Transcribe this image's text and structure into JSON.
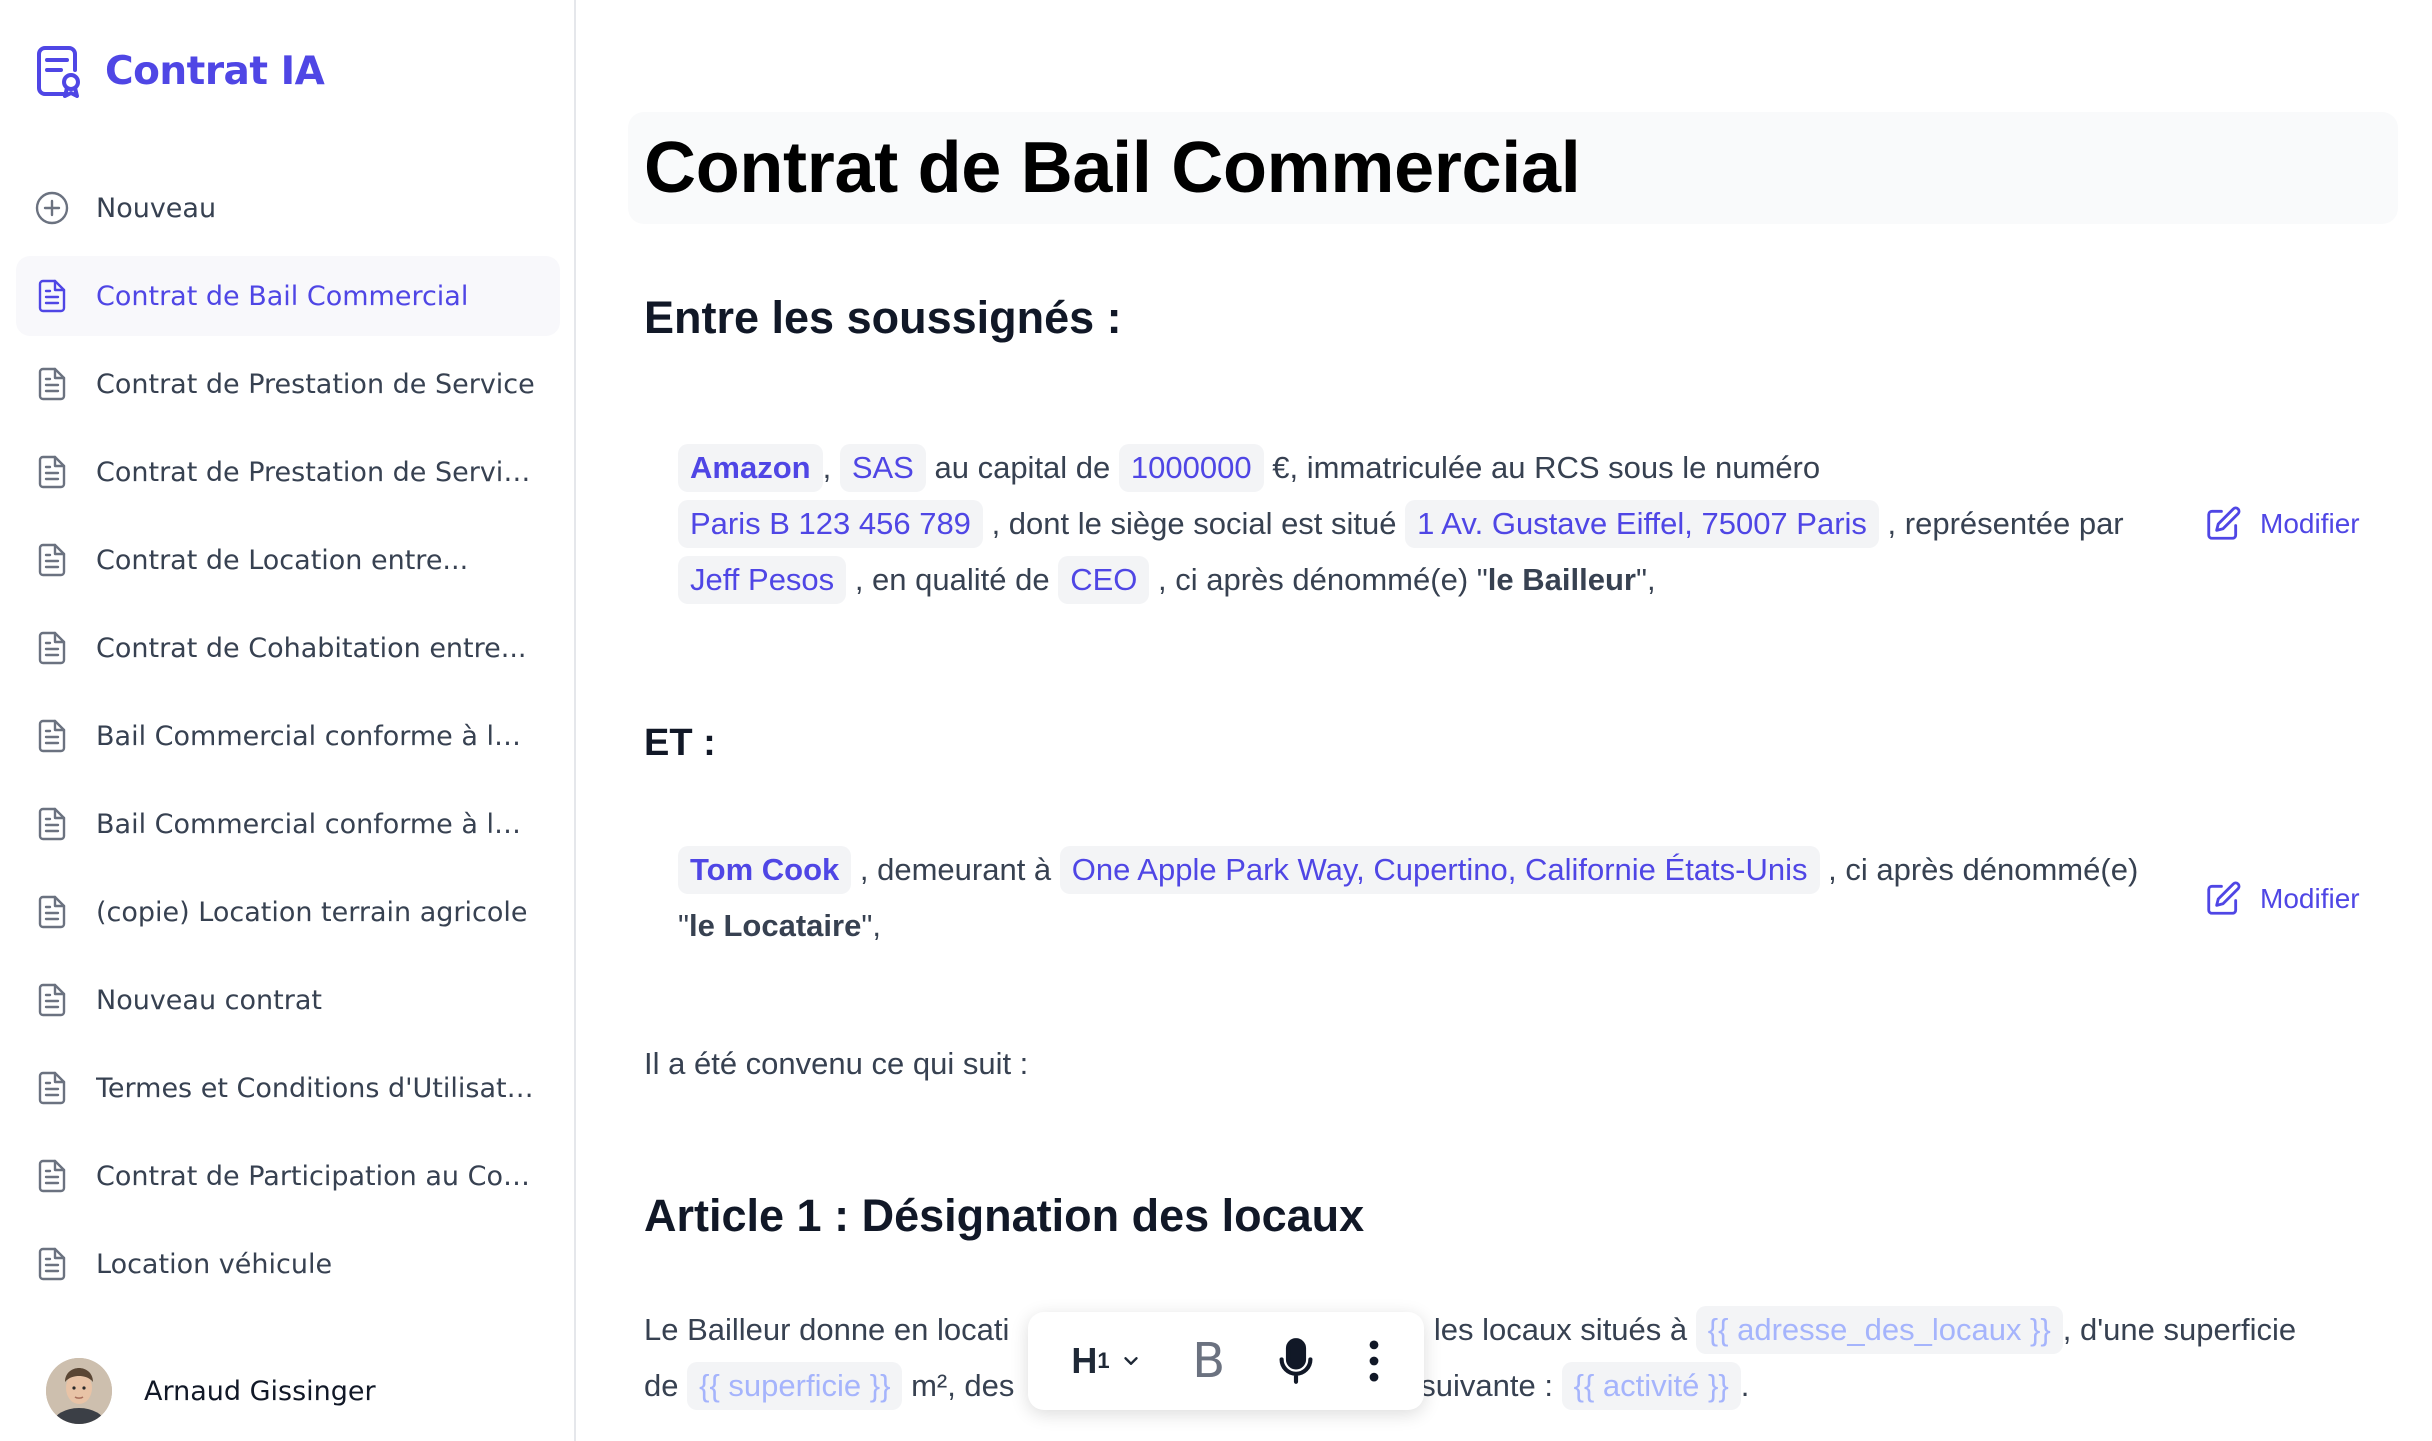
{
  "app": {
    "name": "Contrat IA"
  },
  "sidebar": {
    "new_label": "Nouveau",
    "items": [
      {
        "label": "Contrat de Bail Commercial",
        "active": true
      },
      {
        "label": "Contrat de Prestation de Service"
      },
      {
        "label": "Contrat de Prestation de Servic..."
      },
      {
        "label": "Contrat de Location entre..."
      },
      {
        "label": "Contrat de Cohabitation entre..."
      },
      {
        "label": "Bail Commercial conforme à la l..."
      },
      {
        "label": "Bail Commercial conforme à la l..."
      },
      {
        "label": "(copie) Location terrain agricole"
      },
      {
        "label": "Nouveau contrat"
      },
      {
        "label": "Termes et Conditions d'Utilisati..."
      },
      {
        "label": "Contrat de Participation au Cou..."
      },
      {
        "label": "Location véhicule"
      }
    ]
  },
  "user": {
    "name": "Arnaud Gissinger"
  },
  "document": {
    "title": "Contrat de Bail Commercial",
    "between_heading": "Entre les soussignés :",
    "bailleur": {
      "company": "Amazon",
      "sep1": ",",
      "legal_form": "SAS",
      "t_capital": "au capital de",
      "capital": "1000000",
      "t_rcs": "€, immatriculée au RCS sous le numéro",
      "rcs": "Paris B 123 456 789",
      "t_siege": ", dont le siège social est situé",
      "address": "1 Av. Gustave Eiffel, 75007 Paris",
      "t_rep": ", représentée par",
      "representative": "Jeff Pesos",
      "t_qual": ", en qualité de",
      "role": "CEO",
      "t_after": ", ci après dénommé(e) \"",
      "designation": "le Bailleur",
      "t_end": "\","
    },
    "and_heading": "ET :",
    "locataire": {
      "name": "Tom Cook",
      "t_dem": ", demeurant à",
      "address": "One Apple Park Way, Cupertino, Californie États-Unis",
      "t_after": ", ci après dénommé(e)",
      "t_quote": "\"",
      "designation": "le Locataire",
      "t_end": "\","
    },
    "edit_label": "Modifier",
    "agreed": "Il a été convenu ce qui suit :",
    "article1": {
      "heading": "Article 1 : Désignation des locaux",
      "t1": "Le Bailleur donne en locati",
      "t2": "e, les locaux situés à",
      "ph_adresse": "{{ adresse_des_locaux }}",
      "t3": ", d'une superficie",
      "t4": "de",
      "ph_superficie": "{{ superficie }}",
      "t5": "m², des",
      "t6": "é suivante :",
      "ph_activite": "{{ activité }}",
      "t7": "."
    }
  },
  "toolbar": {
    "heading": "H",
    "heading_level": "1",
    "bold": "B"
  },
  "colors": {
    "accent": "#4f46e5",
    "tag_bg": "#f3f4f6",
    "placeholder": "#a5b4fc"
  }
}
